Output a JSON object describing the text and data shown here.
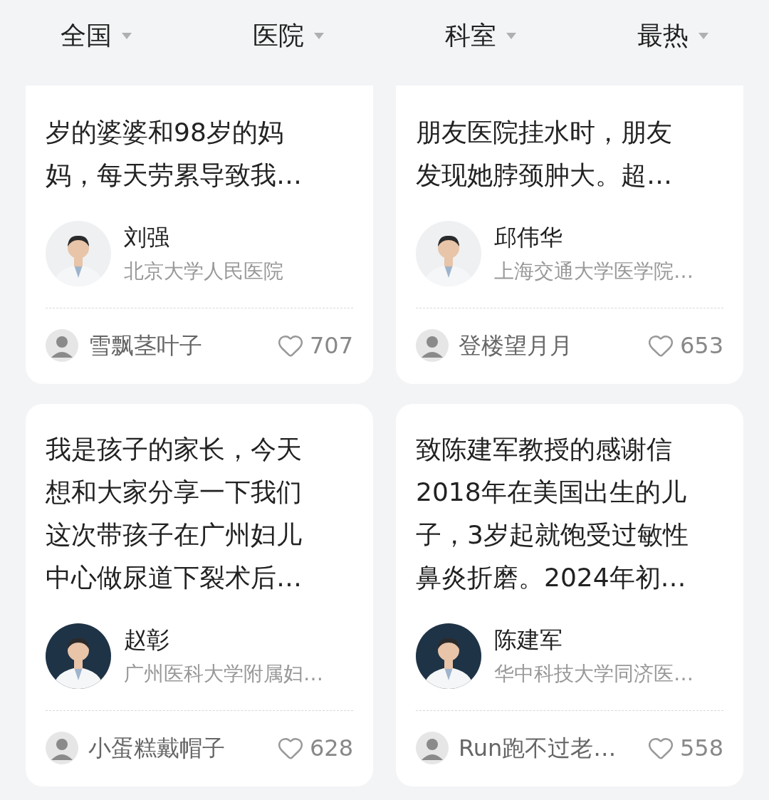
{
  "filters": [
    {
      "label": "全国"
    },
    {
      "label": "医院"
    },
    {
      "label": "科室"
    },
    {
      "label": "最热"
    }
  ],
  "cards": [
    {
      "lines": [
        "岁的婆婆和98岁的妈",
        "妈，每天劳累导致我…"
      ],
      "doctor": {
        "name": "刘强",
        "hospital": "北京大学人民医院"
      },
      "user": {
        "name": "雪飘茎叶子"
      },
      "likes": "707"
    },
    {
      "lines": [
        "朋友医院挂水时，朋友",
        "发现她脖颈肿大。超…"
      ],
      "doctor": {
        "name": "邱伟华",
        "hospital": "上海交通大学医学院…"
      },
      "user": {
        "name": "登楼望月月"
      },
      "likes": "653"
    },
    {
      "lines": [
        "我是孩子的家长，今天",
        "想和大家分享一下我们",
        "这次带孩子在广州妇儿",
        "中心做尿道下裂术后…"
      ],
      "doctor": {
        "name": "赵彰",
        "hospital": "广州医科大学附属妇…"
      },
      "user": {
        "name": "小蛋糕戴帽子"
      },
      "likes": "628"
    },
    {
      "lines": [
        "致陈建军教授的感谢信",
        "2018年在美国出生的儿",
        "子，3岁起就饱受过敏性",
        "鼻炎折磨。2024年初…"
      ],
      "doctor": {
        "name": "陈建军",
        "hospital": "华中科技大学同济医…"
      },
      "user": {
        "name": "Run跑不过老…"
      },
      "likes": "558"
    }
  ]
}
